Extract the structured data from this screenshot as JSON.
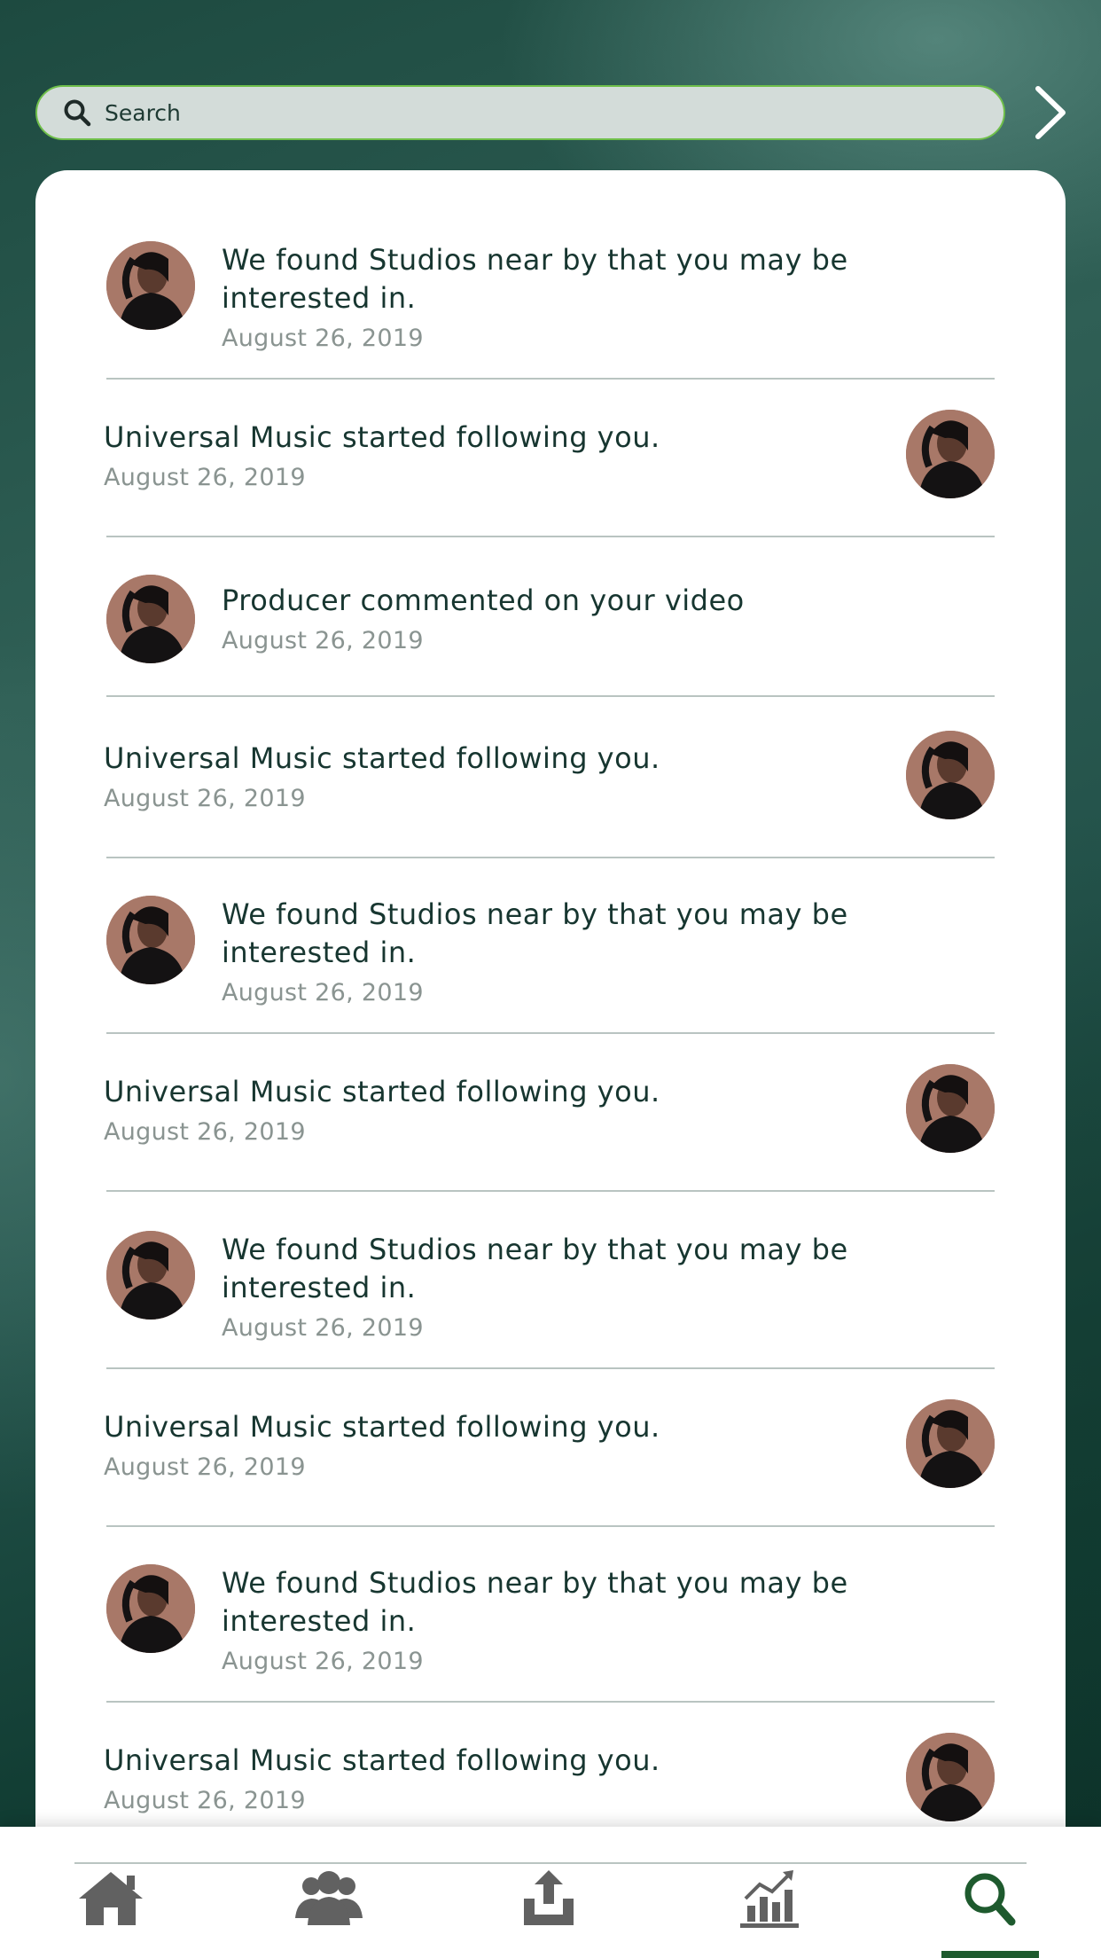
{
  "search": {
    "placeholder": "Search"
  },
  "notifications": [
    {
      "message": "We found Studios near by that you may be interested in.",
      "date": "August 26, 2019"
    },
    {
      "message": "Universal Music started following you.",
      "date": "August 26, 2019"
    },
    {
      "message": "Producer commented on your video",
      "date": "August 26, 2019"
    },
    {
      "message": "Universal Music started following you.",
      "date": "August 26, 2019"
    },
    {
      "message": "We found Studios near by that you may be interested in.",
      "date": "August 26, 2019"
    },
    {
      "message": "Universal Music started following you.",
      "date": "August 26, 2019"
    },
    {
      "message": "We found Studios near by that you may be interested in.",
      "date": "August 26, 2019"
    },
    {
      "message": "Universal Music started following you.",
      "date": "August 26, 2019"
    },
    {
      "message": "We found Studios near by that you may be interested in.",
      "date": "August 26, 2019"
    },
    {
      "message": "Universal Music started following you.",
      "date": "August 26, 2019"
    }
  ],
  "nav": [
    {
      "icon": "home-icon"
    },
    {
      "icon": "users-icon"
    },
    {
      "icon": "upload-icon"
    },
    {
      "icon": "stats-icon"
    },
    {
      "icon": "search-icon",
      "active": true
    }
  ],
  "colors": {
    "accent": "#1e5a2e",
    "search_border": "#6fbf4a",
    "nav_icon": "#616161",
    "text": "#173630",
    "date": "#8a9491"
  }
}
